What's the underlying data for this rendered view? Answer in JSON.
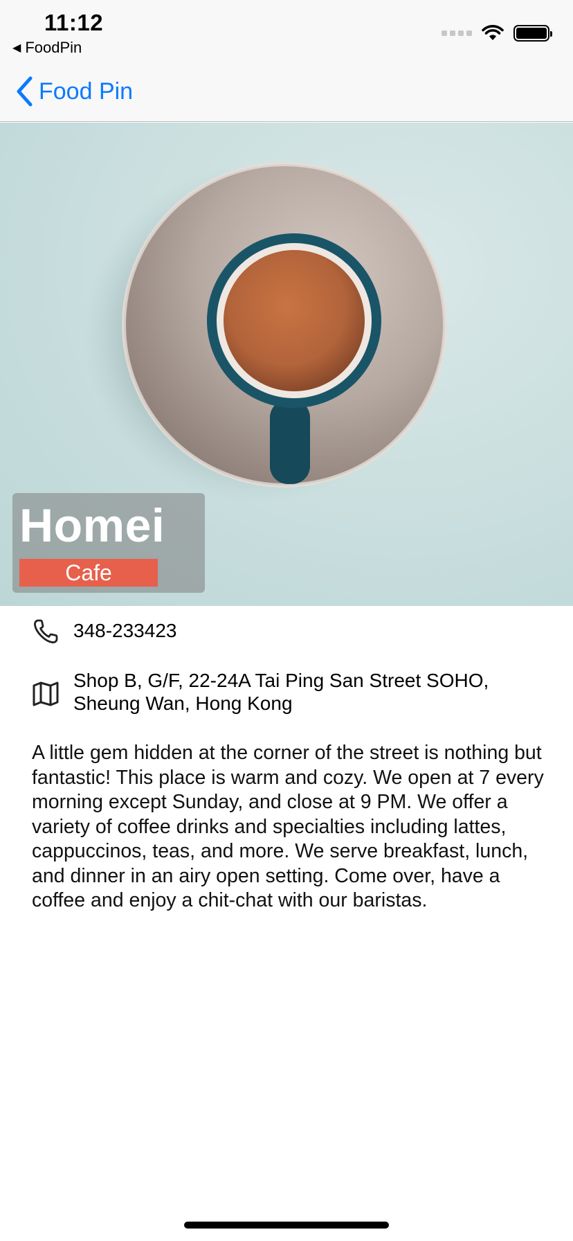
{
  "status_bar": {
    "time": "11:12",
    "back_app_label": "FoodPin"
  },
  "nav": {
    "back_label": "Food Pin"
  },
  "restaurant": {
    "name": "Homei",
    "type": "Cafe",
    "phone": "348-233423",
    "address_line1": "Shop B, G/F, 22-24A Tai Ping San Street SOHO,",
    "address_line2": "Sheung Wan, Hong Kong",
    "description": "A little gem hidden at the corner of the street is nothing but fantastic! This place is warm and cozy. We open at 7 every morning except Sunday, and close at 9 PM. We offer a variety of coffee drinks and specialties including lattes, cappuccinos, teas, and more. We serve breakfast, lunch, and dinner in an airy open setting. Come over, have a coffee and enjoy a chit-chat with our baristas."
  },
  "colors": {
    "accent": "#0a7aff",
    "badge": "#e7604b"
  },
  "icons": {
    "back": "chevron-left-icon",
    "phone": "phone-icon",
    "map": "map-icon",
    "wifi": "wifi-icon",
    "battery": "battery-icon"
  }
}
